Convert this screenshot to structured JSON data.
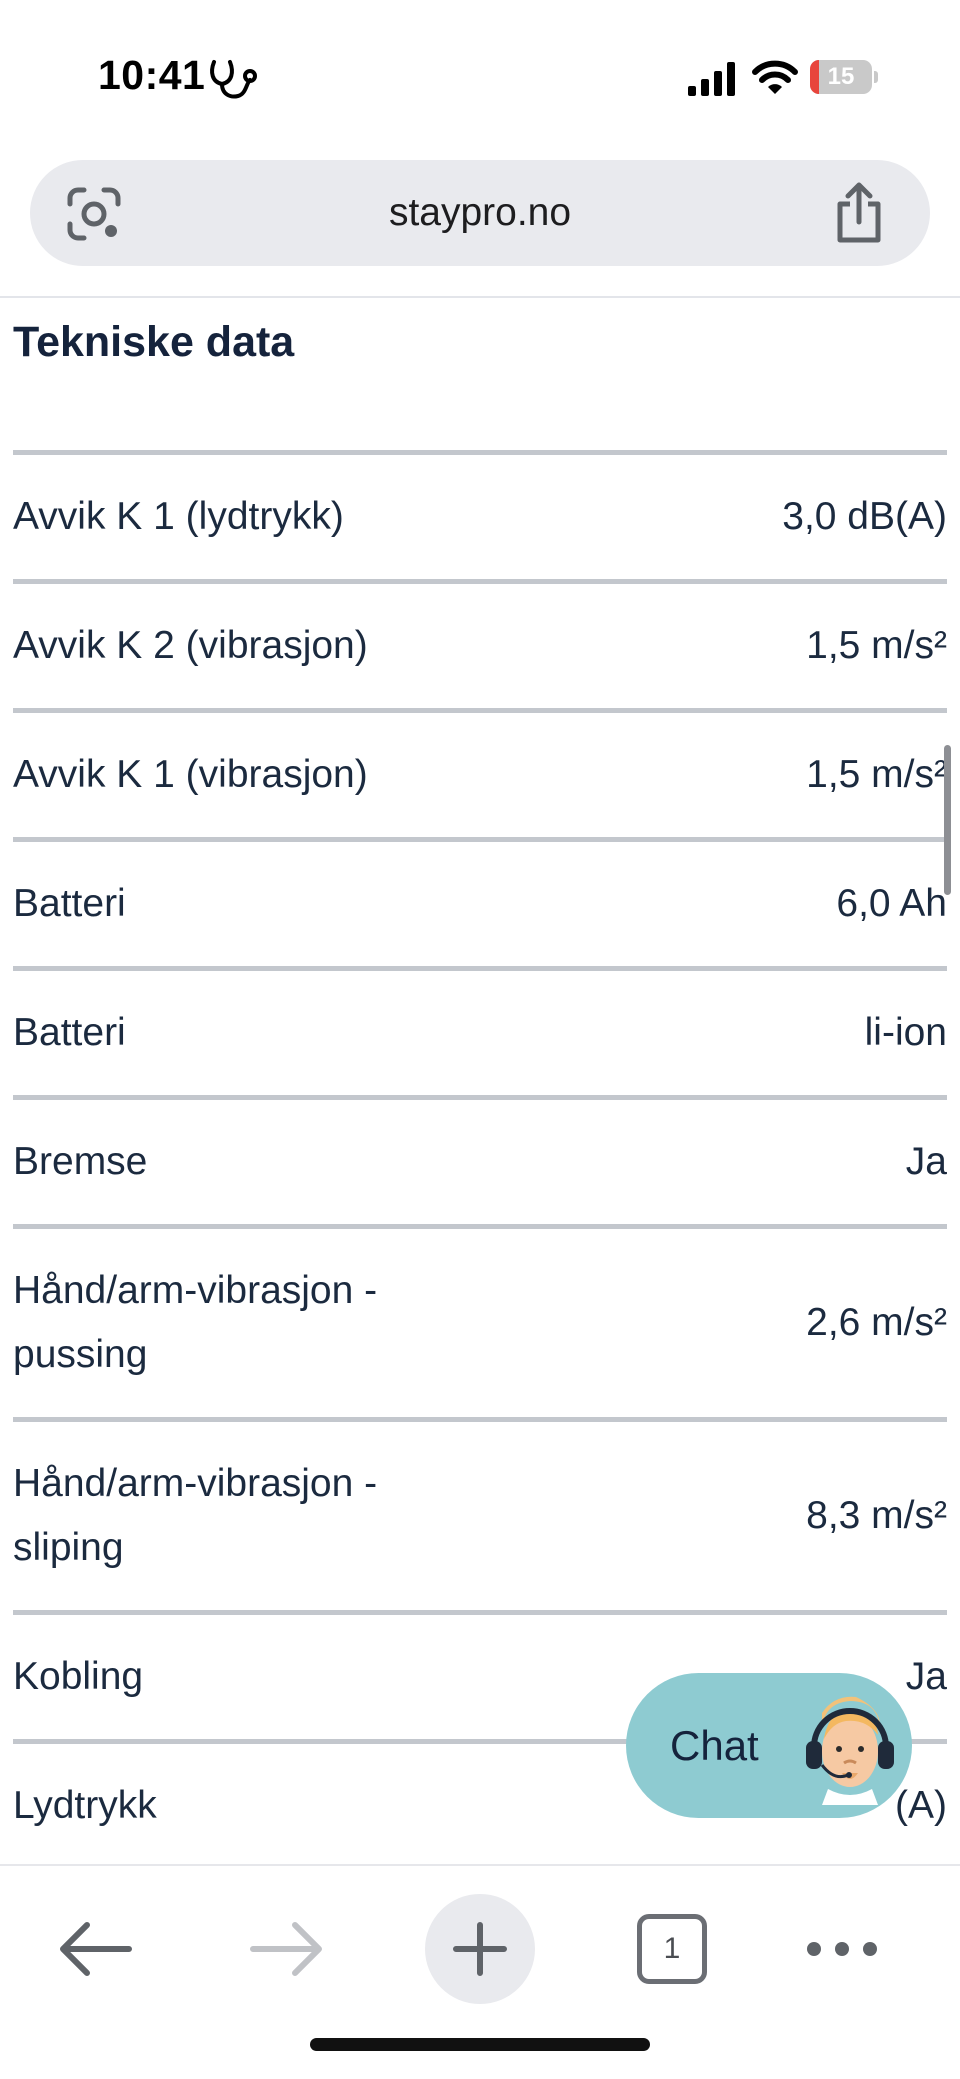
{
  "status_bar": {
    "time": "10:41",
    "battery_level": "15",
    "battery_fraction": 0.15
  },
  "browser": {
    "url": "staypro.no",
    "tab_count": "1"
  },
  "page": {
    "section_title": "Tekniske data",
    "specs": [
      {
        "label": "Avvik K 1 (lydtrykk)",
        "value": "3,0 dB(A)"
      },
      {
        "label": "Avvik K 2 (vibrasjon)",
        "value": "1,5 m/s²"
      },
      {
        "label": "Avvik K 1 (vibrasjon)",
        "value": "1,5 m/s²"
      },
      {
        "label": "Batteri",
        "value": "6,0 Ah"
      },
      {
        "label": "Batteri",
        "value": "li-ion"
      },
      {
        "label": "Bremse",
        "value": "Ja"
      },
      {
        "label": "Hånd/arm-vibrasjon - pussing",
        "value": "2,6 m/s²"
      },
      {
        "label": "Hånd/arm-vibrasjon - sliping",
        "value": "8,3 m/s²"
      },
      {
        "label": "Kobling",
        "value": "Ja"
      },
      {
        "label": "Lydtrykk",
        "value": "(A)"
      }
    ]
  },
  "chat": {
    "label": "Chat"
  },
  "colors": {
    "chat_bubble": "#8ecbd1",
    "text_primary": "#1b2a3f",
    "divider": "#c3c7cd",
    "url_bar": "#e9eaee",
    "battery_low": "#e8453c"
  }
}
